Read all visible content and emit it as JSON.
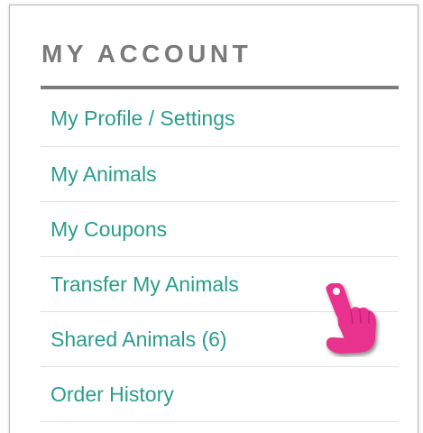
{
  "account_menu": {
    "title": "MY ACCOUNT",
    "items": [
      {
        "label": "My Profile / Settings"
      },
      {
        "label": "My Animals"
      },
      {
        "label": "My Coupons"
      },
      {
        "label": "Transfer My Animals"
      },
      {
        "label": "Shared Animals (6)"
      },
      {
        "label": "Order History"
      }
    ]
  },
  "pointer": {
    "icon": "pointing-hand-icon",
    "color": "#e8338e"
  },
  "colors": {
    "link": "#2a9d8c",
    "heading": "#7a7a7a",
    "rule": "#7b7b7b"
  }
}
